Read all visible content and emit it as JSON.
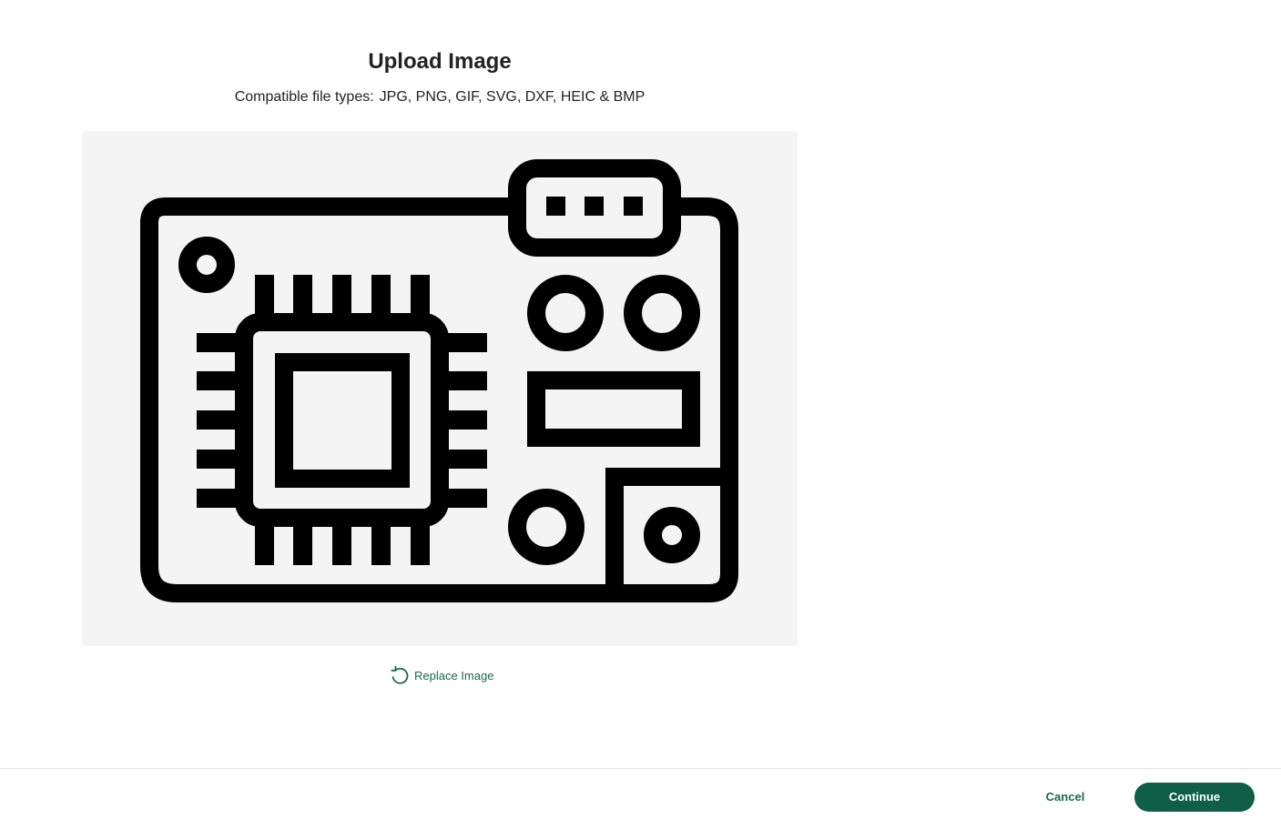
{
  "dialog": {
    "title": "Upload Image",
    "subtitle_label": "Compatible file types:",
    "subtitle_types": "JPG, PNG, GIF, SVG, DXF, HEIC & BMP"
  },
  "preview": {
    "image_icon": "circuit-board-icon",
    "background_color": "#f4f4f4"
  },
  "replace": {
    "label": "Replace Image",
    "icon": "rotate-ccw-icon"
  },
  "footer": {
    "cancel_label": "Cancel",
    "continue_label": "Continue"
  },
  "colors": {
    "accent": "#1a6a4f",
    "primary_button": "#0e5f45"
  }
}
